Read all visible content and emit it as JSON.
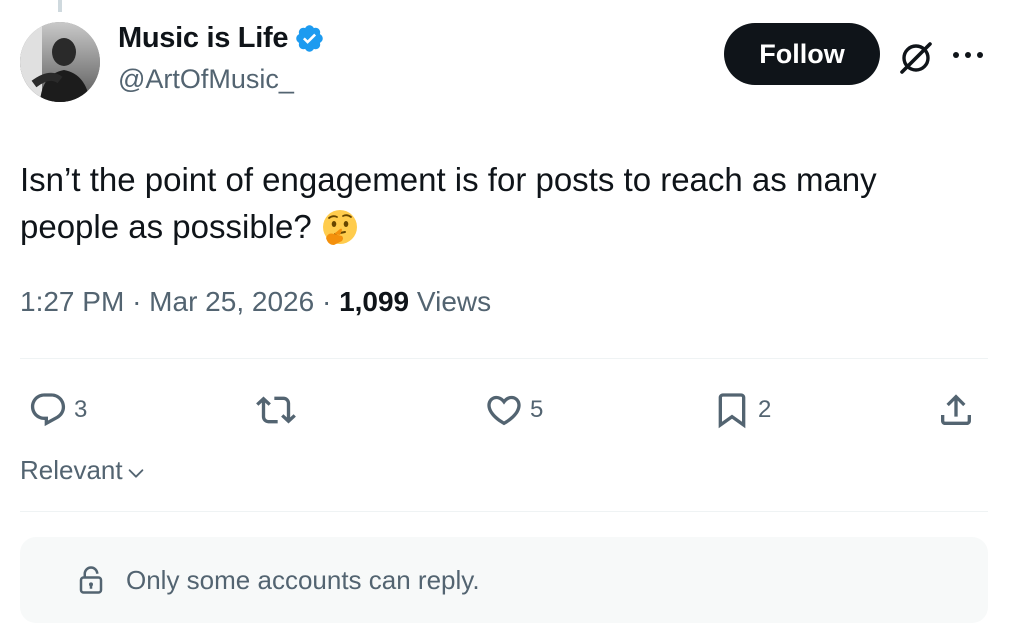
{
  "author": {
    "display_name": "Music is Life",
    "handle": "@ArtOfMusic_",
    "verified": true
  },
  "header": {
    "follow_label": "Follow",
    "icons": [
      "grok-icon",
      "more-icon"
    ]
  },
  "post": {
    "text": "Isn’t the point of engagement is for posts to reach as many people as possible?",
    "emoji": "thinking-face-icon",
    "time": "1:27 PM",
    "date": "Mar 25, 2026",
    "views_count": "1,099",
    "views_label": "Views"
  },
  "actions": {
    "replies": "3",
    "likes": "5",
    "bookmarks": "2"
  },
  "sort": {
    "label": "Relevant"
  },
  "reply_restriction": {
    "text": "Only some accounts can reply."
  },
  "colors": {
    "text": "#0f1419",
    "secondary": "#536471",
    "verified": "#1d9bf0",
    "button": "#0f1419",
    "divider": "#eff3f4"
  }
}
